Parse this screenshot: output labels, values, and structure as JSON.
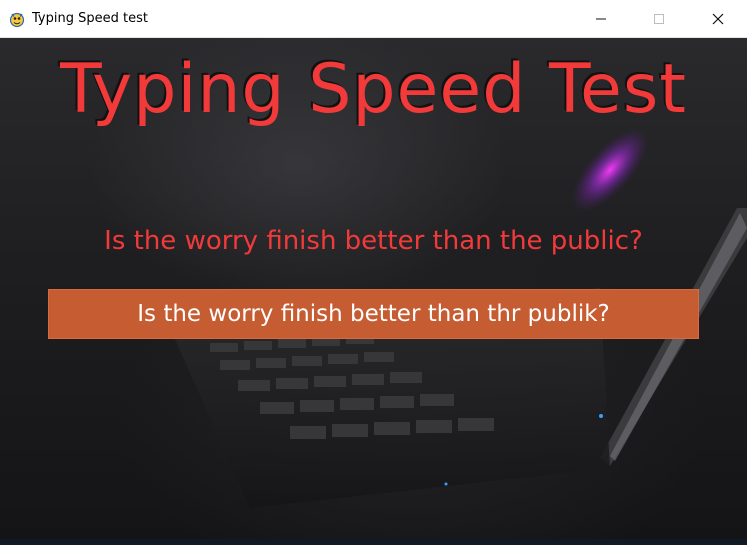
{
  "window": {
    "title": "Typing Speed test",
    "app_icon": "pygame-snake-icon",
    "controls": [
      "minimize-icon",
      "maximize-icon",
      "close-icon"
    ]
  },
  "game": {
    "heading": "Typing Speed Test",
    "prompt_sentence": "Is the worry finish better than the public?",
    "typed_text": "Is the worry finish better than thr publik?"
  },
  "colors": {
    "heading": "#f23a3a",
    "prompt": "#f23a3a",
    "input_box": "#c65c32",
    "input_text": "#ffffff",
    "titlebar": "#ffffff"
  }
}
